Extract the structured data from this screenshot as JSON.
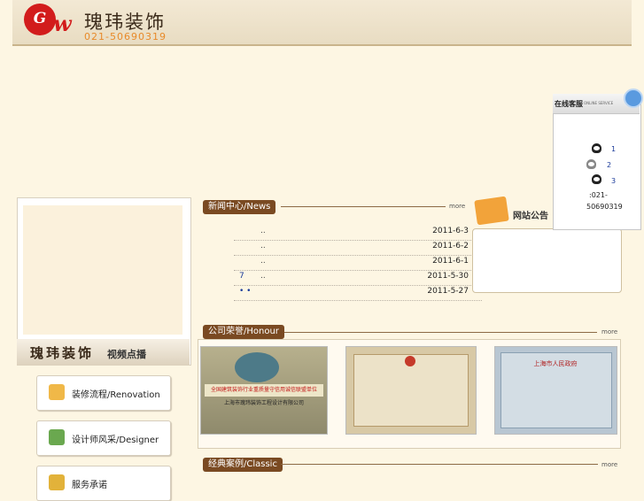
{
  "header": {
    "logo_glyph": "G",
    "logo_w": "w",
    "brand_name": "瑰玮装饰",
    "phone": "021-50690319"
  },
  "video": {
    "title": "瑰玮装饰",
    "subtitle": "视频点播"
  },
  "sidebar_buttons": [
    {
      "label": "装修流程/Renovation"
    },
    {
      "label": "设计师风采/Designer"
    },
    {
      "label": "服务承诺"
    }
  ],
  "news": {
    "title": "新闻中心/News",
    "more": "more",
    "items": [
      {
        "num": "",
        "text": "..",
        "date": "2011-6-3"
      },
      {
        "num": "",
        "text": "..",
        "date": "2011-6-2"
      },
      {
        "num": "",
        "text": "..",
        "date": "2011-6-1"
      },
      {
        "num": "7",
        "text": "..",
        "date": "2011-5-30"
      },
      {
        "num": "• •",
        "text": "",
        "date": "2011-5-27"
      }
    ]
  },
  "notice": {
    "title": "网站公告"
  },
  "honour": {
    "title": "公司荣誉/Honour",
    "more": "more",
    "certs": [
      {
        "caption": "上海市瑰玮装饰工程设计有限公司"
      },
      {
        "caption": ""
      },
      {
        "caption": "上海市人民政府"
      }
    ]
  },
  "classic": {
    "title": "经典案例/Classic",
    "more": "more"
  },
  "online_service": {
    "title": "在线客服",
    "subtitle": "ONLINE SERVICE",
    "contacts": [
      "1",
      "2",
      "3"
    ],
    "phone_line1": ":021-",
    "phone_line2": "50690319"
  }
}
